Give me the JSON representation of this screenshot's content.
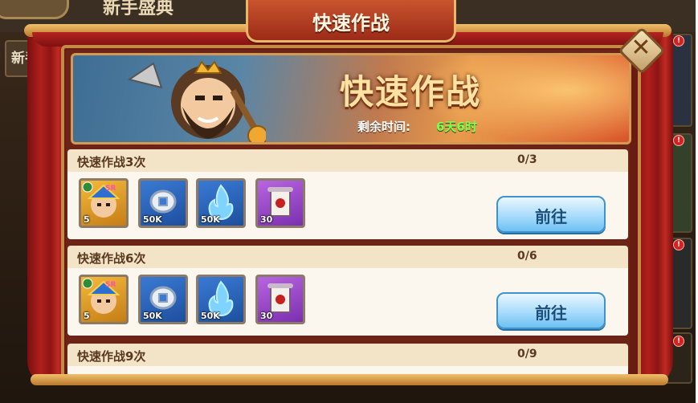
{
  "background": {
    "title": "新手盛典",
    "tab_label": "新手"
  },
  "dialog": {
    "header_title": "快速作战",
    "banner": {
      "title": "快速作战",
      "time_label": "剩余时间:",
      "time_value": "6天6时"
    },
    "tasks": [
      {
        "title": "快速作战3次",
        "progress": "0/3",
        "button": "前往",
        "rewards": [
          {
            "icon": "hero-card-icon",
            "count": "5",
            "badge": "SR"
          },
          {
            "icon": "silver-coin-icon",
            "count": "50K"
          },
          {
            "icon": "blue-flame-icon",
            "count": "50K"
          },
          {
            "icon": "scroll-icon",
            "count": "30"
          }
        ]
      },
      {
        "title": "快速作战6次",
        "progress": "0/6",
        "button": "前往",
        "rewards": [
          {
            "icon": "hero-card-icon",
            "count": "5",
            "badge": "SR"
          },
          {
            "icon": "silver-coin-icon",
            "count": "50K"
          },
          {
            "icon": "blue-flame-icon",
            "count": "50K"
          },
          {
            "icon": "scroll-icon",
            "count": "30"
          }
        ]
      },
      {
        "title": "快速作战9次",
        "progress": "0/9"
      }
    ]
  },
  "colors": {
    "time_green": "#7dff4a",
    "button_blue": "#a8dcfb",
    "panel_red": "#6a1c12"
  }
}
